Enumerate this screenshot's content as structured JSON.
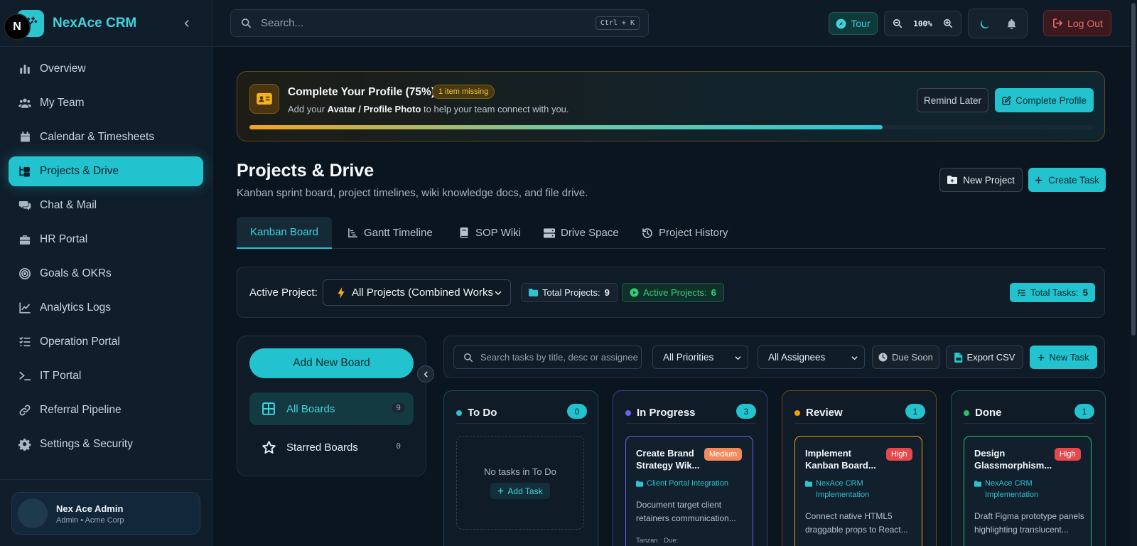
{
  "app": {
    "name": "NexAce CRM",
    "colors": {
      "accent": "#22c3ce",
      "warning": "#f5b21e",
      "danger": "#e5484d",
      "success": "#2fd07a",
      "progress": "#6366f1"
    }
  },
  "sidebar": {
    "items": [
      {
        "label": "Overview",
        "icon": "bar-chart-icon",
        "active": false
      },
      {
        "label": "My Team",
        "icon": "users-icon",
        "active": false
      },
      {
        "label": "Calendar & Timesheets",
        "icon": "calendar-icon",
        "active": false
      },
      {
        "label": "Projects & Drive",
        "icon": "folder-tree-icon",
        "active": true
      },
      {
        "label": "Chat & Mail",
        "icon": "chat-icon",
        "active": false
      },
      {
        "label": "HR Portal",
        "icon": "briefcase-icon",
        "active": false
      },
      {
        "label": "Goals & OKRs",
        "icon": "target-icon",
        "active": false
      },
      {
        "label": "Analytics Logs",
        "icon": "line-chart-icon",
        "active": false
      },
      {
        "label": "Operation Portal",
        "icon": "list-check-icon",
        "active": false
      },
      {
        "label": "IT Portal",
        "icon": "terminal-icon",
        "active": false
      },
      {
        "label": "Referral Pipeline",
        "icon": "link-icon",
        "active": false
      },
      {
        "label": "Settings & Security",
        "icon": "gear-icon",
        "active": false
      }
    ],
    "user": {
      "initial": "N",
      "name": "Nex Ace Admin",
      "role": "Admin • Acme Corp"
    }
  },
  "topbar": {
    "search_placeholder": "Search...",
    "search_shortcut": "Ctrl + K",
    "tour_label": "Tour",
    "zoom_level": "100%",
    "logout_label": "Log Out"
  },
  "profile": {
    "title": "Complete Your Profile (75%)",
    "badge": "1 item missing",
    "desc_prefix": "Add your",
    "desc_bold": "Avatar / Profile Photo",
    "desc_suffix": "to help your team connect with you.",
    "remind_label": "Remind Later",
    "complete_label": "Complete Profile",
    "progress": 0.75
  },
  "page": {
    "title": "Projects & Drive",
    "subtitle": "Kanban sprint board, project timelines, wiki knowledge docs, and file drive.",
    "new_project_label": "New Project",
    "create_task_label": "Create Task"
  },
  "tabs": [
    {
      "label": "Kanban Board",
      "icon": "",
      "active": true
    },
    {
      "label": "Gantt Timeline",
      "icon": "gantt-icon",
      "active": false
    },
    {
      "label": "SOP Wiki",
      "icon": "book-icon",
      "active": false
    },
    {
      "label": "Drive Space",
      "icon": "hard-drive-icon",
      "active": false
    },
    {
      "label": "Project History",
      "icon": "history-icon",
      "active": false
    }
  ],
  "project_bar": {
    "label": "Active Project:",
    "selected": "All Projects (Combined Works",
    "total_projects_label": "Total Projects:",
    "total_projects": "9",
    "active_projects_label": "Active Projects:",
    "active_projects": "6",
    "total_tasks_label": "Total Tasks:",
    "total_tasks": "5"
  },
  "boards": {
    "add_label": "Add New Board",
    "items": [
      {
        "label": "All Boards",
        "count": "9",
        "icon": "grid-icon"
      },
      {
        "label": "Starred Boards",
        "count": "0",
        "icon": "star-icon"
      }
    ]
  },
  "task_toolbar": {
    "search_placeholder": "Search tasks by title, desc or assignee",
    "priority_filter": "All Priorities",
    "assignee_filter": "All Assignees",
    "due_soon_label": "Due Soon",
    "export_label": "Export CSV",
    "new_task_label": "New Task"
  },
  "columns": [
    {
      "title": "To Do",
      "count": "0",
      "dot_color": "#2bc5cf",
      "border": "#1d4a5a",
      "empty_text": "No tasks in To Do",
      "add_label": "Add Task",
      "cards": []
    },
    {
      "title": "In Progress",
      "count": "3",
      "dot_color": "#6366f1",
      "border": "#3b3f8a",
      "cards": [
        {
          "title": "Create Brand Strategy Wik...",
          "priority": "Medium",
          "project": "Client Portal Integration",
          "desc": "Document target client retainers communication...",
          "meta_a": "Tanzan",
          "meta_b": "Due:"
        }
      ]
    },
    {
      "title": "Review",
      "count": "1",
      "dot_color": "#f59e0b",
      "border": "#6a4c12",
      "cards": [
        {
          "title": "Implement Kanban Board...",
          "priority": "High",
          "project": "NexAce CRM Implementation",
          "desc": "Connect native HTML5 draggable props to React...",
          "meta_a": "",
          "meta_b": ""
        }
      ]
    },
    {
      "title": "Done",
      "count": "1",
      "dot_color": "#22c55e",
      "border": "#1a5a4a",
      "cards": [
        {
          "title": "Design Glassmorphism...",
          "priority": "High",
          "project": "NexAce CRM Implementation",
          "desc": "Draft Figma prototype panels highlighting translucent...",
          "meta_a": "",
          "meta_b": ""
        }
      ]
    }
  ]
}
